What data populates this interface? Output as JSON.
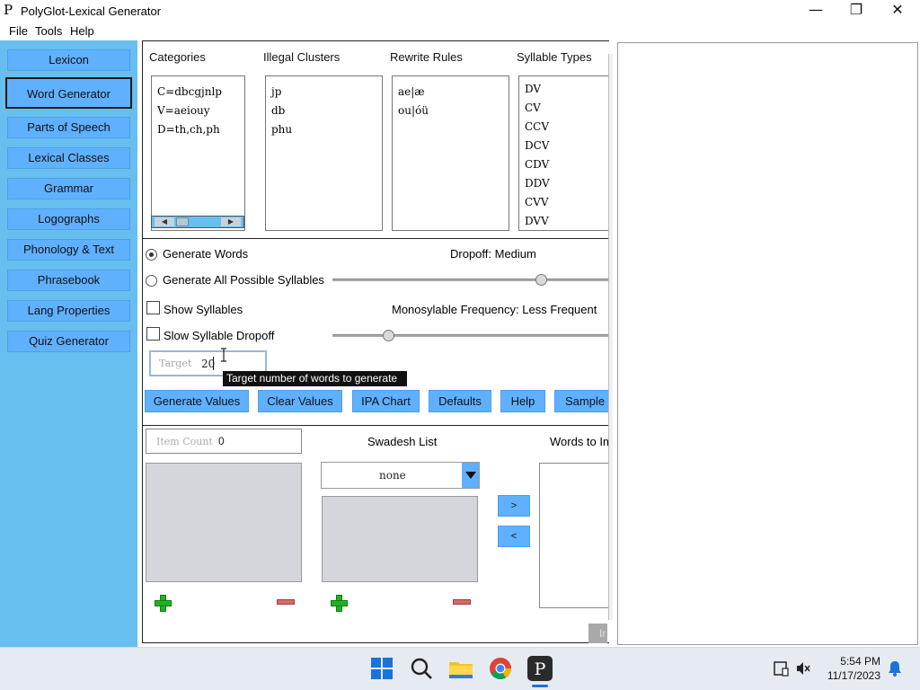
{
  "window": {
    "title": "PolyGlot-Lexical Generator",
    "icon_glyph": "P",
    "minimize_glyph": "—",
    "maximize_glyph": "❐",
    "close_glyph": "✕"
  },
  "menu": [
    "File",
    "Tools",
    "Help"
  ],
  "sidebar": {
    "items": [
      {
        "label": "Lexicon",
        "active": false
      },
      {
        "label": "Word Generator",
        "active": true
      },
      {
        "label": "Parts of Speech",
        "active": false
      },
      {
        "label": "Lexical Classes",
        "active": false
      },
      {
        "label": "Grammar",
        "active": false
      },
      {
        "label": "Logographs",
        "active": false
      },
      {
        "label": "Phonology & Text",
        "active": false
      },
      {
        "label": "Phrasebook",
        "active": false
      },
      {
        "label": "Lang Properties",
        "active": false
      },
      {
        "label": "Quiz Generator",
        "active": false
      }
    ]
  },
  "panels": {
    "categories": {
      "label": "Categories",
      "rows": [
        "C=dbcgjnlp",
        "V=aeiouy",
        "D=th,ch,ph"
      ]
    },
    "illegal_clusters": {
      "label": "Illegal Clusters",
      "rows": [
        "jp",
        "db",
        "phu"
      ]
    },
    "rewrite_rules": {
      "label": "Rewrite Rules",
      "rows": [
        "ae|æ",
        "ou|óü"
      ]
    },
    "syllable_types": {
      "label": "Syllable Types",
      "rows": [
        "DV",
        "CV",
        "CCV",
        "DCV",
        "CDV",
        "DDV",
        "CVV",
        "DVV"
      ]
    }
  },
  "options": {
    "generate_words": {
      "label": "Generate Words",
      "selected": true
    },
    "generate_all_syllables": {
      "label": "Generate All Possible Syllables",
      "selected": false
    },
    "show_syllables": {
      "label": "Show Syllables",
      "checked": false
    },
    "slow_syllable_dropoff": {
      "label": "Slow Syllable Dropoff",
      "checked": false
    },
    "dropoff": {
      "label": "Dropoff: Medium",
      "level": 0.76
    },
    "monosyllable_frequency": {
      "label": "Monosylable Frequency: Less Frequent",
      "level": 0.2
    }
  },
  "target": {
    "placeholder": "Target",
    "value": "20",
    "tooltip": "Target number of words to generate"
  },
  "actions": [
    "Generate Values",
    "Clear Values",
    "IPA Chart",
    "Defaults",
    "Help",
    "Sample"
  ],
  "bottom": {
    "item_count_placeholder": "Item Count",
    "item_count_value": "0",
    "swadesh_label": "Swadesh List",
    "swadesh_selected": "none",
    "words_to_import_label": "Words to Im",
    "move_right": ">",
    "move_left": "<",
    "corner_text": "Ir"
  },
  "taskbar": {
    "time": "5:54 PM",
    "date": "11/17/2023"
  }
}
